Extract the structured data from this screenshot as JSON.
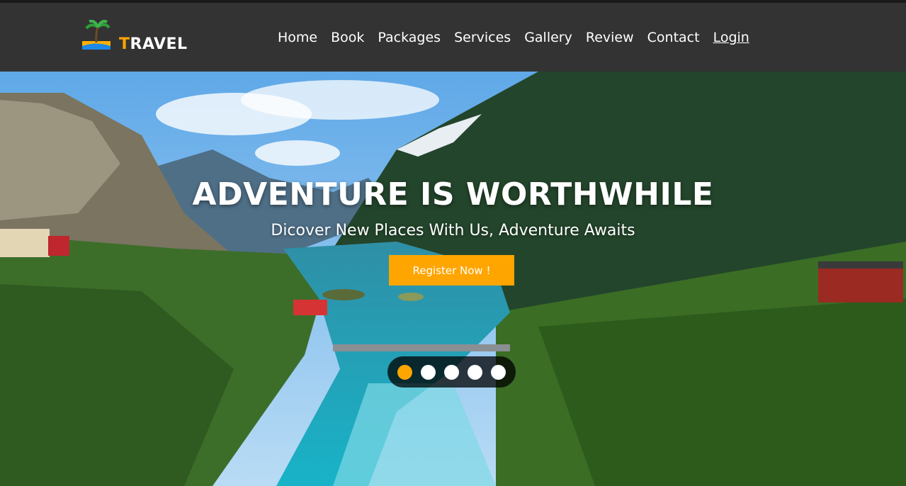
{
  "brand": {
    "first_letter": "T",
    "rest": "RAVEL",
    "accent_color": "#ffa500"
  },
  "nav": {
    "items": [
      {
        "label": "Home"
      },
      {
        "label": "Book"
      },
      {
        "label": "Packages"
      },
      {
        "label": "Services"
      },
      {
        "label": "Gallery"
      },
      {
        "label": "Review"
      },
      {
        "label": "Contact"
      }
    ],
    "login": "Login"
  },
  "hero": {
    "headline": "ADVENTURE IS WORTHWHILE",
    "subheadline": "Dicover New Places With Us, Adventure Awaits",
    "cta_label": "Register Now !",
    "slides": {
      "count": 5,
      "active_index": 0
    }
  },
  "colors": {
    "navbar": "#333333",
    "accent": "#ffa500",
    "text": "#ffffff"
  }
}
